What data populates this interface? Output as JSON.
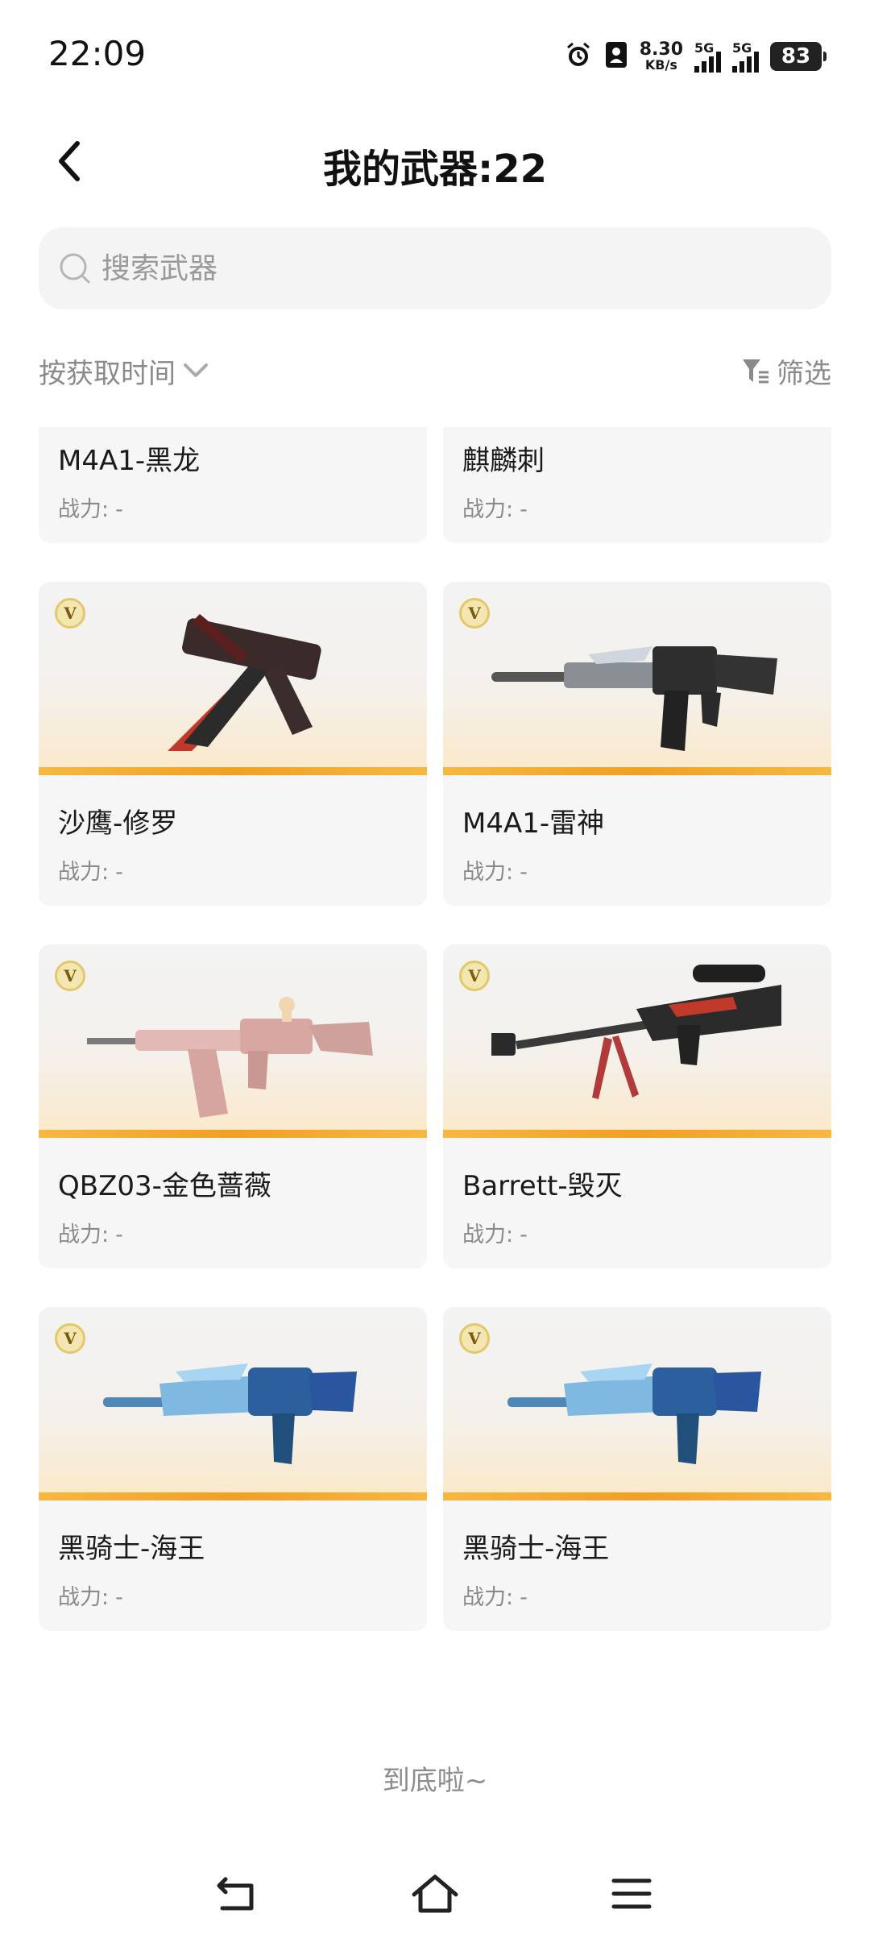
{
  "status_bar": {
    "time": "22:09",
    "net_speed_value": "8.30",
    "net_speed_unit": "KB/s",
    "sim1": "5G",
    "sim2": "5G",
    "battery": "83"
  },
  "header": {
    "title": "我的武器:22"
  },
  "search": {
    "placeholder": "搜索武器"
  },
  "sort": {
    "label": "按获取时间",
    "filter_label": "筛选"
  },
  "power_label": "战力:",
  "weapons": [
    {
      "name": "M4A1-黑龙",
      "power": "-",
      "badge": false
    },
    {
      "name": "麒麟刺",
      "power": "-",
      "badge": false
    },
    {
      "name": "沙鹰-修罗",
      "power": "-",
      "badge": true
    },
    {
      "name": "M4A1-雷神",
      "power": "-",
      "badge": true
    },
    {
      "name": "QBZ03-金色蔷薇",
      "power": "-",
      "badge": true
    },
    {
      "name": "Barrett-毁灭",
      "power": "-",
      "badge": true
    },
    {
      "name": "黑骑士-海王",
      "power": "-",
      "badge": true
    },
    {
      "name": "黑骑士-海王",
      "power": "-",
      "badge": true
    }
  ],
  "badge_letter": "V",
  "end_text": "到底啦~",
  "colors": {
    "accent": "#f1a021",
    "card_bg": "#f6f6f6",
    "muted_text": "#8a8a8a"
  }
}
